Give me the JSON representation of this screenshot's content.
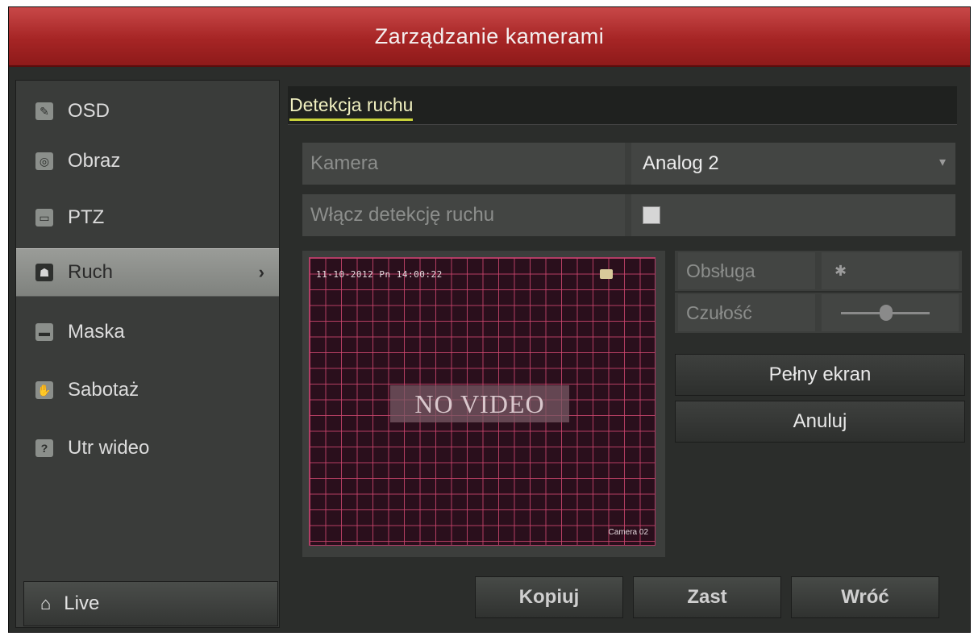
{
  "window": {
    "title": "Zarządzanie kamerami"
  },
  "sidebar": {
    "items": [
      {
        "label": "OSD",
        "icon": "pencil-icon"
      },
      {
        "label": "Obraz",
        "icon": "palette-icon"
      },
      {
        "label": "PTZ",
        "icon": "ptz-icon"
      },
      {
        "label": "Ruch",
        "icon": "motion-icon",
        "active": true
      },
      {
        "label": "Maska",
        "icon": "mask-icon"
      },
      {
        "label": "Sabotaż",
        "icon": "hand-icon"
      },
      {
        "label": "Utr wideo",
        "icon": "video-loss-icon"
      }
    ],
    "live_label": "Live"
  },
  "section": {
    "title": "Detekcja ruchu"
  },
  "form": {
    "camera_label": "Kamera",
    "camera_value": "Analog 2",
    "enable_label": "Włącz detekcję ruchu"
  },
  "preview": {
    "osd_time": "11-10-2012 Pn 14:00:22",
    "no_video": "NO VIDEO",
    "camera_label": "Camera 02"
  },
  "settings": {
    "handling_label": "Obsługa",
    "sensitivity_label": "Czułość",
    "fullscreen_label": "Pełny ekran",
    "cancel_label": "Anuluj"
  },
  "actions": {
    "copy_label": "Kopiuj",
    "apply_label": "Zast",
    "back_label": "Wróć"
  },
  "colors": {
    "titlebar": "#a62525",
    "grid": "#cd466e",
    "active_item": "#8f928e",
    "section_underline": "#c9d23a"
  }
}
